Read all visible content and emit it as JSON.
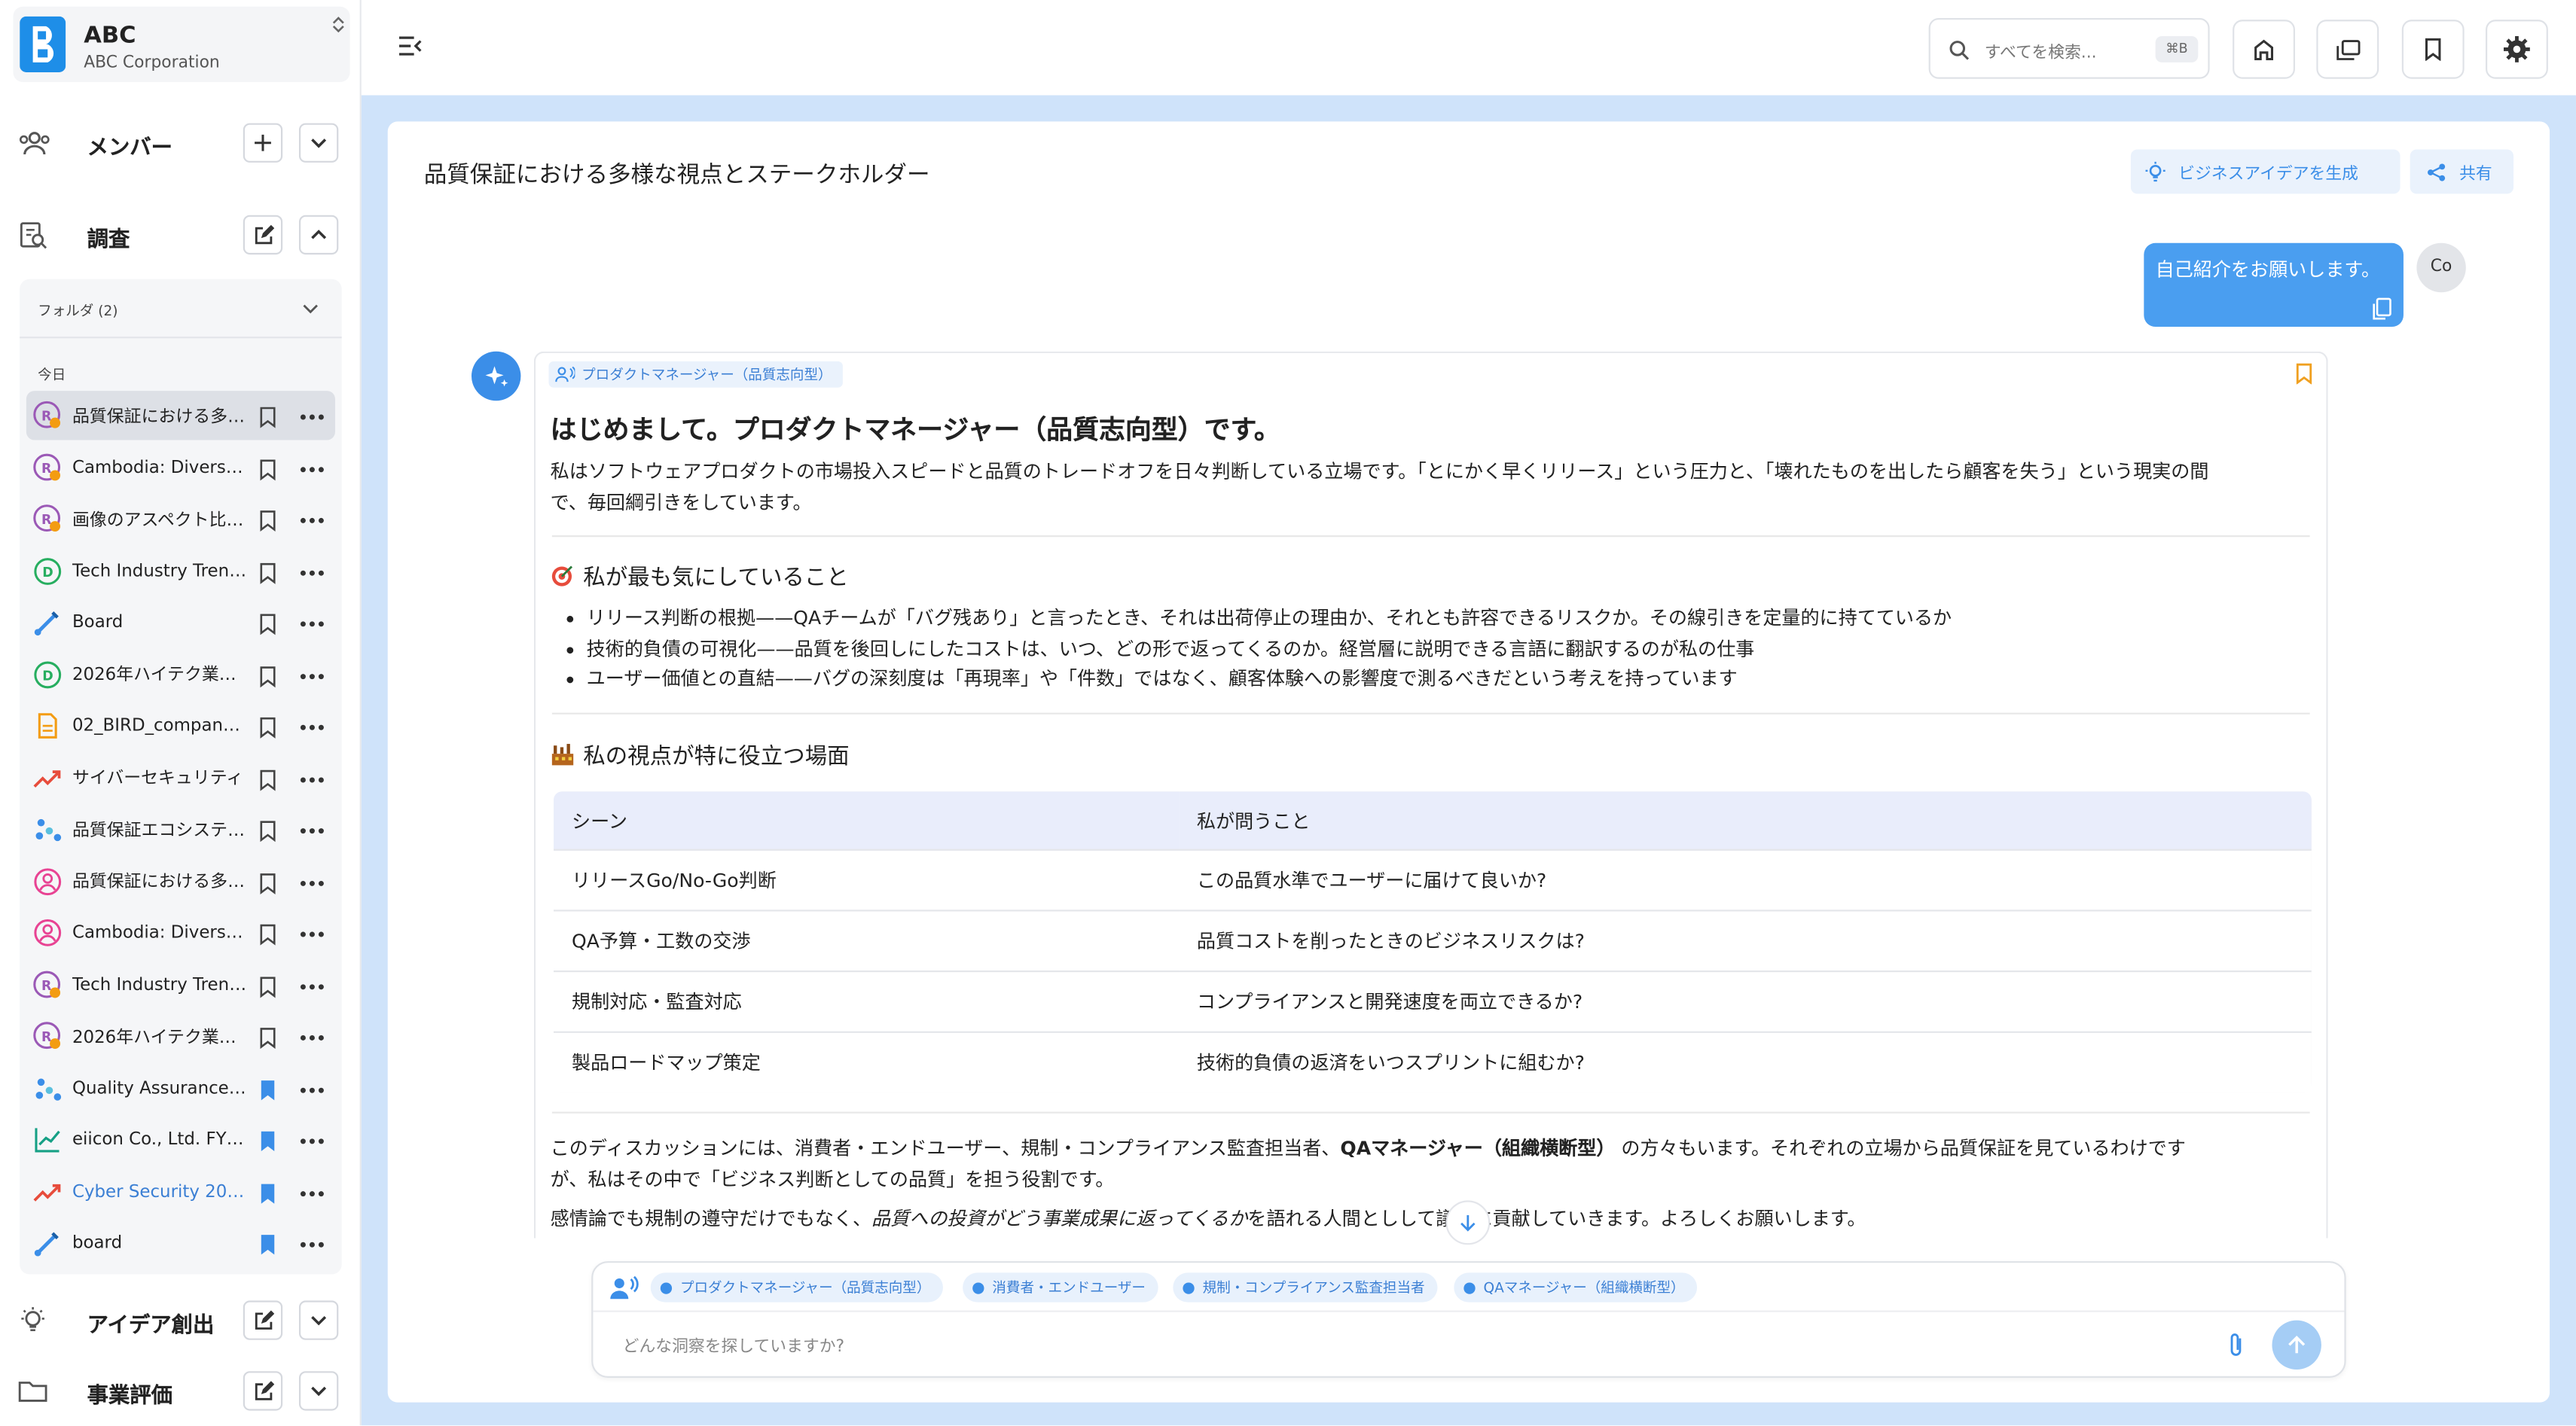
{
  "org": {
    "name": "ABC",
    "subtitle": "ABC Corporation"
  },
  "sidebar": {
    "members_label": "メンバー",
    "research_label": "調査",
    "folder_label": "フォルダ (2)",
    "today_label": "今日",
    "items": [
      {
        "label": "品質保証における多…",
        "icon": "persona-research-icon",
        "color": "#9b59b6",
        "bookmarked": false,
        "active": true
      },
      {
        "label": "Cambodia: Diverse …",
        "icon": "persona-research-icon",
        "color": "#9b59b6",
        "bookmarked": false
      },
      {
        "label": "画像のアスペクト比…",
        "icon": "persona-research-icon",
        "color": "#9b59b6",
        "bookmarked": false
      },
      {
        "label": "Tech Industry Trend…",
        "icon": "data-icon",
        "color": "#27ae60",
        "bookmarked": false
      },
      {
        "label": "Board",
        "icon": "board-icon",
        "color": "#3b8ee8",
        "bookmarked": false
      },
      {
        "label": "2026年ハイテク業…",
        "icon": "data-icon",
        "color": "#27ae60",
        "bookmarked": false
      },
      {
        "label": "02_BIRD_company_…",
        "icon": "document-icon",
        "color": "#f39c12",
        "bookmarked": false
      },
      {
        "label": "サイバーセキュリティ",
        "icon": "trend-icon",
        "color": "#e74c3c",
        "bookmarked": false
      },
      {
        "label": "品質保証エコシステ…",
        "icon": "scatter-icon",
        "color": "#3b8ee8",
        "bookmarked": false
      },
      {
        "label": "品質保証における多…",
        "icon": "user-circle-icon",
        "color": "#e84393",
        "bookmarked": false
      },
      {
        "label": "Cambodia: Diverse …",
        "icon": "user-circle-icon",
        "color": "#e84393",
        "bookmarked": false
      },
      {
        "label": "Tech Industry Trend…",
        "icon": "persona-research-icon",
        "color": "#9b59b6",
        "bookmarked": false
      },
      {
        "label": "2026年ハイテク業…",
        "icon": "persona-research-icon",
        "color": "#9b59b6",
        "bookmarked": false
      },
      {
        "label": "Quality Assurance …",
        "icon": "scatter-icon",
        "color": "#3b8ee8",
        "bookmarked": true
      },
      {
        "label": "eiicon Co., Ltd. FY2…",
        "icon": "line-chart-icon",
        "color": "#16a085",
        "bookmarked": true
      },
      {
        "label": "Cyber Security 2026",
        "icon": "trend-icon",
        "color": "#e74c3c",
        "bookmarked": true,
        "link": true
      },
      {
        "label": "board",
        "icon": "board-icon",
        "color": "#3b8ee8",
        "bookmarked": true
      }
    ],
    "ideas_label": "アイデア創出",
    "evaluation_label": "事業評価"
  },
  "topbar": {
    "search_placeholder": "すべてを検索...",
    "shortcut": "⌘B"
  },
  "chat": {
    "title": "品質保証における多様な視点とステークホルダー",
    "generate_btn": "ビジネスアイデアを生成",
    "share_btn": "共有",
    "user_message": "自己紹介をお願いします。",
    "user_avatar": "Co",
    "persona_tag": "プロダクトマネージャー（品質志向型）",
    "heading": "はじめまして。プロダクトマネージャー（品質志向型）です。",
    "intro": [
      "私はソフトウェアプロダクトの市場投入スピードと品質のトレードオフを日々判断している立場です。「とにかく早くリリース」という圧力と、「壊れたものを出したら顧客を失う」という現実の間",
      "で、毎回綱引きをしています。"
    ],
    "section1_title": "私が最も気にしていること",
    "section1_items": [
      "リリース判断の根拠——QAチームが「バグ残あり」と言ったとき、それは出荷停止の理由か、それとも許容できるリスクか。その線引きを定量的に持てているか",
      "技術的負債の可視化——品質を後回しにしたコストは、いつ、どの形で返ってくるのか。経営層に説明できる言語に翻訳するのが私の仕事",
      "ユーザー価値との直結——バグの深刻度は「再現率」や「件数」ではなく、顧客体験への影響度で測るべきだという考えを持っています"
    ],
    "section2_title": "私の視点が特に役立つ場面",
    "table": {
      "headers": [
        "シーン",
        "私が問うこと"
      ],
      "rows": [
        [
          "リリースGo/No-Go判断",
          "この品質水準でユーザーに届けて良いか?"
        ],
        [
          "QA予算・工数の交渉",
          "品質コストを削ったときのビジネスリスクは?"
        ],
        [
          "規制対応・監査対応",
          "コンプライアンスと開発速度を両立できるか?"
        ],
        [
          "製品ロードマップ策定",
          "技術的負債の返済をいつスプリントに組むか?"
        ]
      ]
    },
    "closing1": [
      "このディスカッションには、消費者・エンドユーザー、規制・コンプライアンス監査担当者、",
      "QAマネージャー（組織横断型）",
      " の方々もいます。それぞれの立場から品質保証を見ているわけです",
      "が、私はその中で「ビジネス判断としての品質」を担う役割です。"
    ],
    "closing2": [
      "感情論でも規制の遵守だけでもなく、",
      "品質への投資がどう事業成果に返ってくるか",
      "を語れる人間としして議論に貢献していきます。よろしくお願いします。"
    ]
  },
  "composer": {
    "chips": [
      "プロダクトマネージャー（品質志向型）",
      "消費者・エンドユーザー",
      "規制・コンプライアンス監査担当者",
      "QAマネージャー（組織横断型）"
    ],
    "placeholder": "どんな洞察を探していますか?"
  },
  "colors": {
    "accent": "#3b8ee8",
    "user_bubble": "#4a9ef0",
    "main_bg": "#cfe3fa"
  }
}
